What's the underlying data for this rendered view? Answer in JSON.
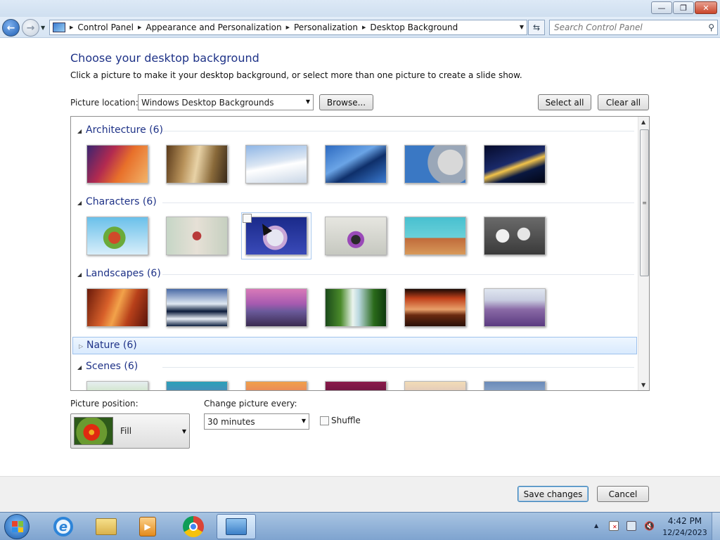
{
  "window": {
    "minimize_label": "—",
    "maximize_label": "❐",
    "close_label": "✕"
  },
  "nav": {
    "back_icon": "back-arrow-icon",
    "forward_icon": "forward-arrow-icon",
    "breadcrumbs": [
      "Control Panel",
      "Appearance and Personalization",
      "Personalization",
      "Desktop Background"
    ],
    "search_placeholder": "Search Control Panel"
  },
  "content": {
    "title": "Choose your desktop background",
    "description": "Click a picture to make it your desktop background, or select more than one picture to create a slide show.",
    "picture_location_label": "Picture location:",
    "picture_location_value": "Windows Desktop Backgrounds",
    "browse_label": "Browse...",
    "select_all_label": "Select all",
    "clear_all_label": "Clear all"
  },
  "groups": [
    {
      "title": "Architecture (6)",
      "expanded": true
    },
    {
      "title": "Characters (6)",
      "expanded": true
    },
    {
      "title": "Landscapes (6)",
      "expanded": true
    },
    {
      "title": "Nature (6)",
      "expanded": false
    },
    {
      "title": "Scenes (6)",
      "expanded": true
    }
  ],
  "options": {
    "position_label": "Picture position:",
    "position_value": "Fill",
    "change_label": "Change picture every:",
    "change_value": "30 minutes",
    "shuffle_label": "Shuffle",
    "shuffle_checked": false
  },
  "footer": {
    "save_label": "Save changes",
    "cancel_label": "Cancel"
  },
  "taskbar": {
    "apps": [
      "internet-explorer",
      "windows-explorer",
      "media-player",
      "chrome",
      "control-panel"
    ],
    "active_app": "control-panel",
    "time": "4:42 PM",
    "date": "12/24/2023"
  },
  "colors": {
    "heading": "#1e3287",
    "taskbar": "#7ea3cf",
    "selected_group": "#d9eafd"
  }
}
